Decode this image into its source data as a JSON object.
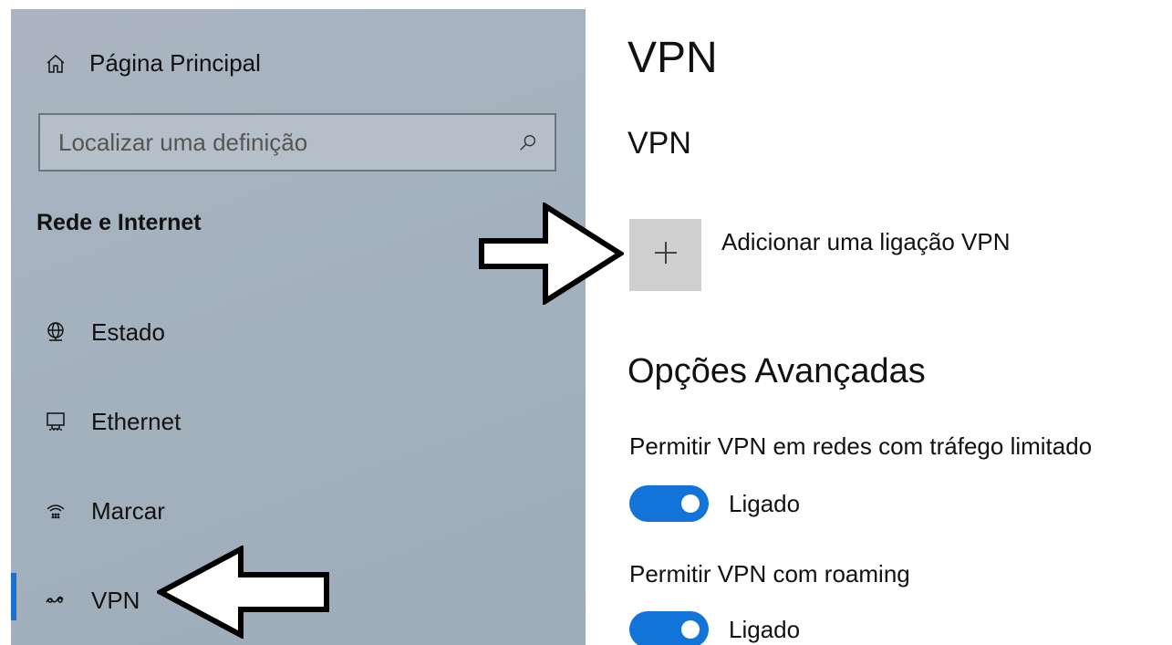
{
  "sidebar": {
    "home": {
      "label": "Página Principal",
      "icon": "home-icon"
    },
    "search": {
      "placeholder": "Localizar uma definição",
      "icon": "search-icon"
    },
    "section_title": "Rede e Internet",
    "items": [
      {
        "label": "Estado",
        "icon": "globe-icon"
      },
      {
        "label": "Ethernet",
        "icon": "ethernet-icon"
      },
      {
        "label": "Marcar",
        "icon": "dial-up-icon"
      },
      {
        "label": "VPN",
        "icon": "vpn-icon",
        "selected": true
      }
    ],
    "accent_color": "#1a6fd0"
  },
  "main": {
    "title": "VPN",
    "subtitle": "VPN",
    "add_vpn": {
      "label": "Adicionar uma ligação VPN",
      "icon": "plus-icon"
    },
    "advanced_title": "Opções Avançadas",
    "settings": [
      {
        "label": "Permitir VPN em redes com tráfego limitado",
        "state": "Ligado",
        "on": true
      },
      {
        "label": "Permitir VPN com roaming",
        "state": "Ligado",
        "on": true
      }
    ],
    "toggle_color": "#1273d8"
  },
  "annotations": [
    {
      "type": "arrow",
      "direction": "right",
      "target": "add-vpn-button"
    },
    {
      "type": "arrow",
      "direction": "left",
      "target": "sidebar-item-vpn"
    }
  ]
}
